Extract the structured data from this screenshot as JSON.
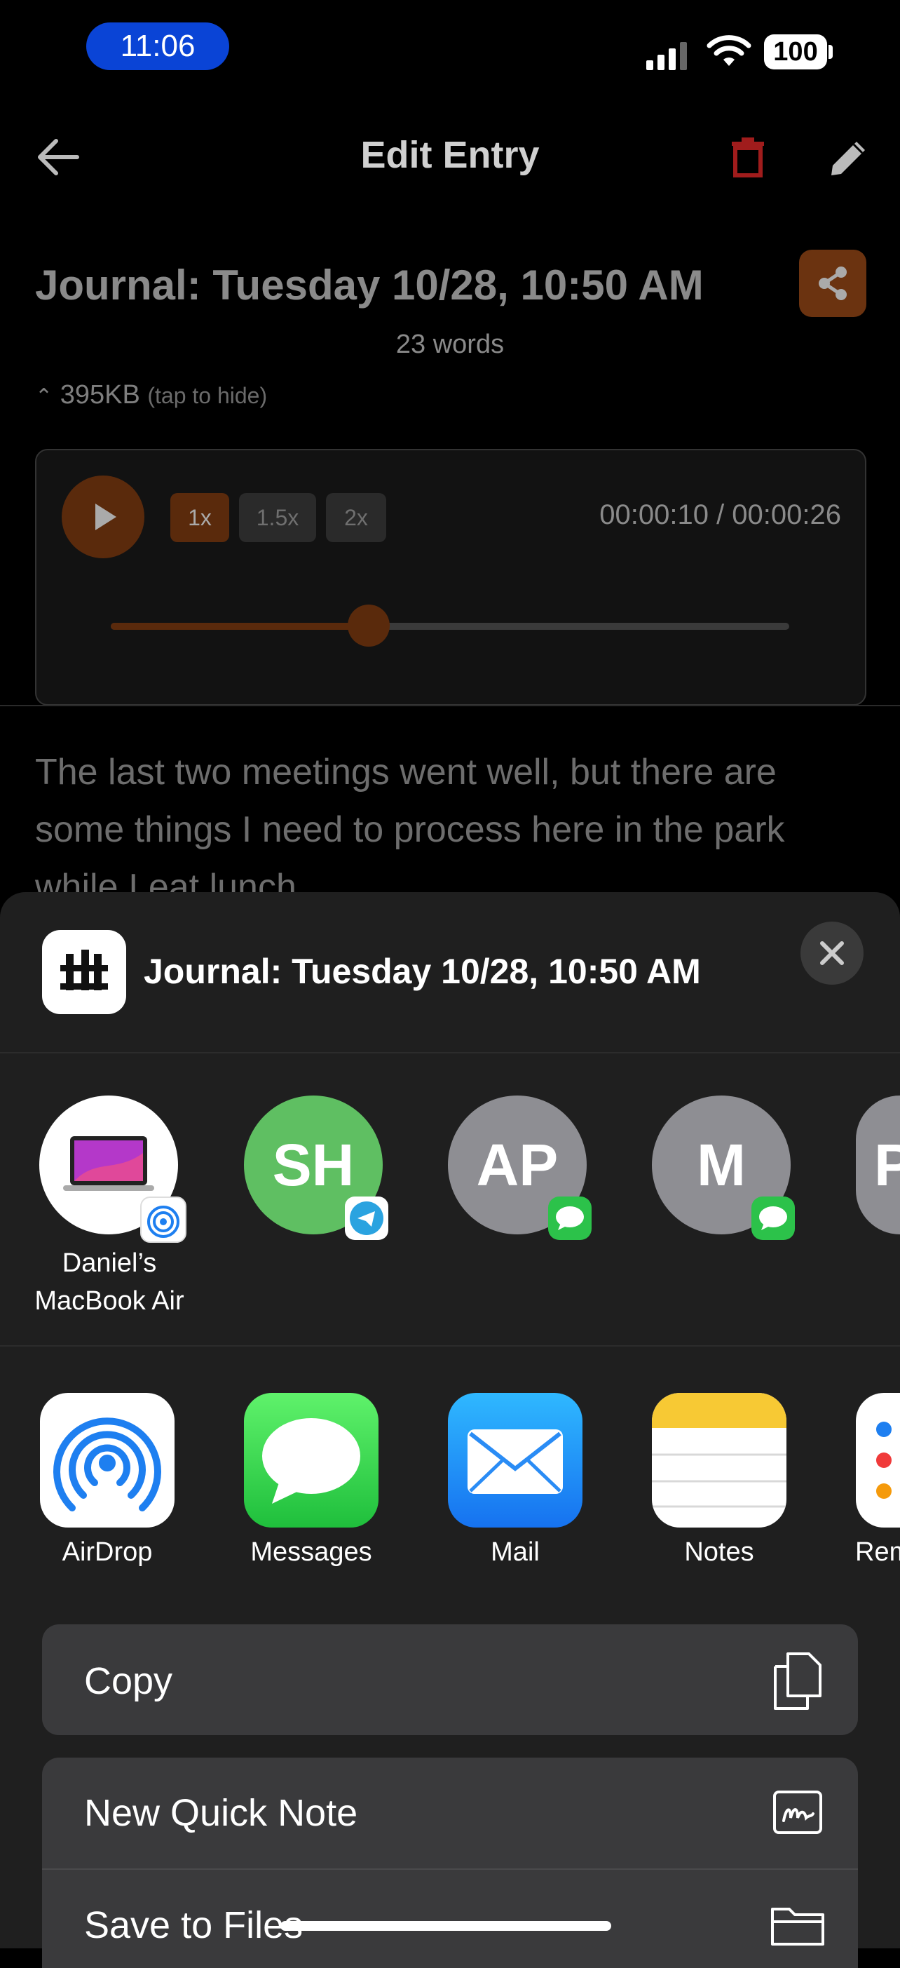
{
  "status_bar": {
    "time": "11:06",
    "battery": "100"
  },
  "header": {
    "title": "Edit Entry"
  },
  "entry": {
    "title": "Journal: Tuesday 10/28, 10:50 AM",
    "word_count": "23 words",
    "size": "395KB",
    "size_hint": "(tap to hide)",
    "body": "The last two meetings went well, but there are some things I need to process here in the park while I eat lunch..."
  },
  "player": {
    "speeds": [
      "1x",
      "1.5x",
      "2x"
    ],
    "selected_speed": "1x",
    "timecode": "00:00:10 / 00:00:26",
    "progress": 0.38
  },
  "share_sheet": {
    "title": "Journal: Tuesday 10/28, 10:50 AM",
    "people": [
      {
        "initials": "",
        "label_line1": "Daniel’s",
        "label_line2": "MacBook Air",
        "badge": "airdrop"
      },
      {
        "initials": "SH",
        "label_line1": "",
        "label_line2": "",
        "badge": "telegram"
      },
      {
        "initials": "AP",
        "label_line1": "",
        "label_line2": "",
        "badge": "messages"
      },
      {
        "initials": "M",
        "label_line1": "",
        "label_line2": "",
        "badge": "messages"
      },
      {
        "initials": "P",
        "label_line1": "",
        "label_line2": "",
        "badge": ""
      }
    ],
    "apps": [
      "AirDrop",
      "Messages",
      "Mail",
      "Notes",
      "Rem"
    ],
    "actions": [
      "Copy",
      "New Quick Note",
      "Save to Files"
    ]
  },
  "colors": {
    "accent": "#6b3310",
    "delete": "#a01c1c",
    "sheet_bg": "#1f1f1f"
  }
}
